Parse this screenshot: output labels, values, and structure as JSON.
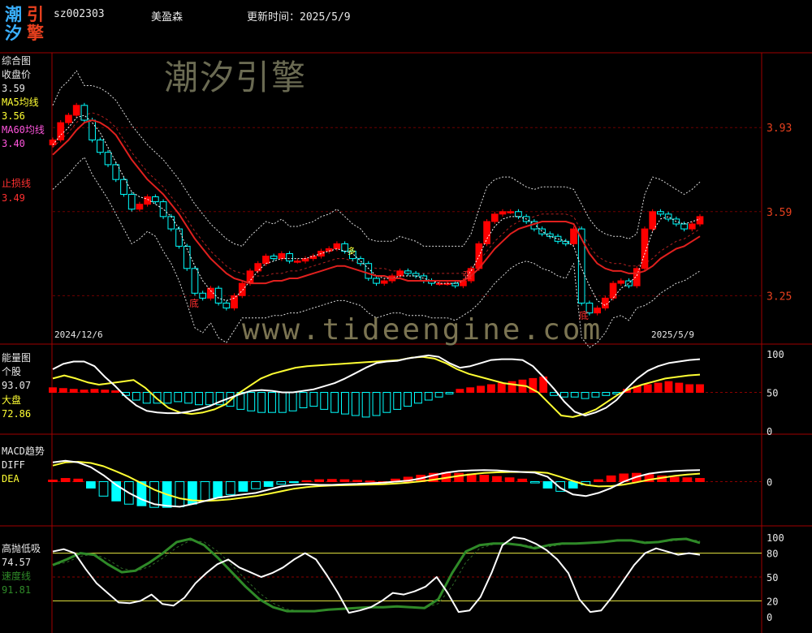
{
  "header": {
    "logo_chars": [
      "潮",
      "引",
      "汐",
      "擎"
    ],
    "code": "sz002303",
    "name": "美盈森",
    "update_label": "更新时间：2025/5/9"
  },
  "watermark": {
    "cn": "潮汐引擎",
    "url": "www.tideengine.com"
  },
  "colors": {
    "up": "#ff0000",
    "down": "#00ffff",
    "ma60": "#e0201e",
    "yellow": "#ffff33",
    "green": "#2f8a28",
    "grid": "#a00000"
  },
  "main_panel": {
    "labels": {
      "title": "综合图",
      "close_label": "收盘价",
      "close_value": "3.59",
      "ma5_label": "MA5均线",
      "ma5_value": "3.56",
      "ma60_label": "MA60均线",
      "ma60_value": "3.40",
      "stop_label": "止损线",
      "stop_value": "3.49"
    },
    "axis_ticks": [
      "3.93",
      "3.59",
      "3.25"
    ],
    "date_start": "2024/12/6",
    "date_end": "2025/5/9",
    "marks": {
      "bottom1": "底",
      "bottom2": "底",
      "strong": "强",
      "dup": "多"
    }
  },
  "energy_panel": {
    "labels": {
      "title": "能量图",
      "stock_label": "个股",
      "stock_value": "93.07",
      "market_label": "大盘",
      "market_value": "72.86"
    },
    "axis_ticks": [
      "100",
      "50",
      "0"
    ]
  },
  "macd_panel": {
    "labels": {
      "title": "MACD趋势",
      "diff_label": "DIFF",
      "dea_label": "DEA"
    },
    "axis_ticks": [
      "0"
    ]
  },
  "absorb_panel": {
    "labels": {
      "title": "高抛低吸",
      "value1": "74.57",
      "speed_label": "速度线",
      "speed_value": "91.81"
    },
    "axis_ticks": [
      "100",
      "80",
      "50",
      "20",
      "0"
    ]
  },
  "chart_data": [
    {
      "type": "candlestick",
      "panel": "综合图",
      "x_start": "2024/12/6",
      "x_end": "2025/5/9",
      "ylim": [
        3.1,
        4.2
      ],
      "close": [
        3.88,
        3.95,
        3.98,
        4.02,
        3.96,
        3.88,
        3.83,
        3.78,
        3.72,
        3.66,
        3.6,
        3.62,
        3.65,
        3.63,
        3.57,
        3.52,
        3.45,
        3.36,
        3.26,
        3.24,
        3.28,
        3.22,
        3.2,
        3.25,
        3.3,
        3.35,
        3.38,
        3.41,
        3.4,
        3.42,
        3.39,
        3.39,
        3.4,
        3.41,
        3.43,
        3.44,
        3.46,
        3.43,
        3.4,
        3.38,
        3.32,
        3.3,
        3.31,
        3.33,
        3.35,
        3.34,
        3.33,
        3.31,
        3.3,
        3.3,
        3.3,
        3.29,
        3.31,
        3.36,
        3.46,
        3.55,
        3.58,
        3.59,
        3.59,
        3.57,
        3.55,
        3.52,
        3.5,
        3.49,
        3.47,
        3.46,
        3.52,
        3.22,
        3.18,
        3.2,
        3.24,
        3.3,
        3.31,
        3.29,
        3.36,
        3.52,
        3.59,
        3.58,
        3.56,
        3.54,
        3.52,
        3.54,
        3.57
      ],
      "ma5": [
        3.86,
        3.9,
        3.93,
        3.97,
        3.98,
        3.95,
        3.91,
        3.85,
        3.79,
        3.73,
        3.67,
        3.65,
        3.64,
        3.62,
        3.6,
        3.57,
        3.52,
        3.44,
        3.37,
        3.31,
        3.27,
        3.24,
        3.23,
        3.24,
        3.27,
        3.31,
        3.35,
        3.38,
        3.39,
        3.4,
        3.4,
        3.4,
        3.4,
        3.41,
        3.42,
        3.43,
        3.44,
        3.43,
        3.42,
        3.39,
        3.36,
        3.33,
        3.32,
        3.32,
        3.33,
        3.33,
        3.33,
        3.32,
        3.31,
        3.3,
        3.3,
        3.3,
        3.31,
        3.35,
        3.41,
        3.48,
        3.53,
        3.56,
        3.57,
        3.57,
        3.56,
        3.54,
        3.51,
        3.49,
        3.48,
        3.47,
        3.45,
        3.36,
        3.29,
        3.23,
        3.21,
        3.24,
        3.28,
        3.3,
        3.33,
        3.42,
        3.51,
        3.56,
        3.57,
        3.55,
        3.54,
        3.55,
        3.56
      ],
      "ma60": [
        3.82,
        3.85,
        3.88,
        3.92,
        3.95,
        3.96,
        3.95,
        3.93,
        3.9,
        3.85,
        3.8,
        3.76,
        3.72,
        3.69,
        3.66,
        3.62,
        3.58,
        3.53,
        3.48,
        3.44,
        3.4,
        3.37,
        3.34,
        3.32,
        3.31,
        3.3,
        3.3,
        3.3,
        3.31,
        3.31,
        3.32,
        3.32,
        3.33,
        3.34,
        3.35,
        3.36,
        3.37,
        3.37,
        3.36,
        3.35,
        3.34,
        3.33,
        3.33,
        3.32,
        3.32,
        3.31,
        3.31,
        3.31,
        3.31,
        3.31,
        3.31,
        3.31,
        3.31,
        3.33,
        3.36,
        3.4,
        3.44,
        3.47,
        3.5,
        3.52,
        3.53,
        3.54,
        3.55,
        3.55,
        3.55,
        3.55,
        3.54,
        3.48,
        3.42,
        3.38,
        3.36,
        3.35,
        3.35,
        3.34,
        3.34,
        3.35,
        3.37,
        3.4,
        3.42,
        3.44,
        3.45,
        3.47,
        3.49
      ]
    },
    {
      "type": "line+bar",
      "panel": "能量图",
      "ylim": [
        0,
        100
      ],
      "stock": [
        80,
        87,
        90,
        90,
        84,
        70,
        58,
        44,
        33,
        26,
        24,
        23,
        23,
        25,
        28,
        32,
        38,
        43,
        48,
        52,
        53,
        52,
        50,
        50,
        52,
        54,
        58,
        62,
        68,
        75,
        82,
        88,
        90,
        91,
        94,
        96,
        98,
        96,
        88,
        82,
        84,
        88,
        92,
        93,
        93,
        92,
        84,
        70,
        55,
        38,
        25,
        20,
        24,
        30,
        40,
        55,
        68,
        78,
        84,
        88,
        90,
        92,
        93
      ],
      "market": [
        68,
        72,
        68,
        63,
        60,
        62,
        64,
        66,
        56,
        42,
        30,
        24,
        22,
        24,
        28,
        35,
        48,
        58,
        68,
        74,
        78,
        82,
        84,
        85,
        86,
        87,
        88,
        89,
        90,
        91,
        92,
        95,
        96,
        94,
        88,
        80,
        74,
        70,
        66,
        62,
        60,
        58,
        50,
        35,
        20,
        18,
        22,
        28,
        38,
        48,
        55,
        60,
        64,
        68,
        70,
        72,
        73
      ],
      "histogram": [
        6,
        5,
        4,
        3,
        4,
        3,
        2,
        -4,
        -10,
        -14,
        -14,
        -14,
        -12,
        -14,
        -16,
        -16,
        -16,
        -18,
        -22,
        -24,
        -26,
        -26,
        -26,
        -24,
        -20,
        -18,
        -22,
        -26,
        -28,
        -30,
        -32,
        -30,
        -26,
        -22,
        -18,
        -14,
        -10,
        -6,
        -2,
        4,
        6,
        8,
        10,
        12,
        14,
        16,
        18,
        20,
        -4,
        -6,
        -6,
        -8,
        -6,
        -4,
        -2,
        4,
        8,
        10,
        12,
        14,
        12,
        10,
        10
      ]
    },
    {
      "type": "line+bar",
      "panel": "MACD趋势",
      "ylim": [
        -0.12,
        0.12
      ],
      "diff": [
        0.06,
        0.065,
        0.06,
        0.045,
        0.02,
        -0.01,
        -0.035,
        -0.055,
        -0.07,
        -0.075,
        -0.078,
        -0.07,
        -0.06,
        -0.05,
        -0.045,
        -0.04,
        -0.035,
        -0.025,
        -0.015,
        -0.01,
        -0.008,
        -0.01,
        -0.01,
        -0.008,
        -0.007,
        -0.005,
        -0.003,
        0.0,
        0.003,
        0.01,
        0.02,
        0.028,
        0.033,
        0.035,
        0.036,
        0.035,
        0.032,
        0.03,
        0.028,
        0.015,
        -0.02,
        -0.04,
        -0.045,
        -0.035,
        -0.02,
        0.0,
        0.015,
        0.025,
        0.03,
        0.033,
        0.035,
        0.036
      ],
      "dea": [
        0.05,
        0.06,
        0.062,
        0.058,
        0.048,
        0.032,
        0.015,
        -0.005,
        -0.025,
        -0.04,
        -0.052,
        -0.058,
        -0.06,
        -0.058,
        -0.055,
        -0.05,
        -0.045,
        -0.038,
        -0.03,
        -0.022,
        -0.017,
        -0.014,
        -0.012,
        -0.011,
        -0.01,
        -0.009,
        -0.008,
        -0.006,
        -0.003,
        0.001,
        0.006,
        0.012,
        0.018,
        0.023,
        0.027,
        0.029,
        0.03,
        0.03,
        0.03,
        0.027,
        0.015,
        0.002,
        -0.01,
        -0.015,
        -0.014,
        -0.009,
        -0.002,
        0.006,
        0.012,
        0.018,
        0.022,
        0.025
      ],
      "histogram": [
        0.005,
        0.01,
        0.008,
        -0.02,
        -0.045,
        -0.06,
        -0.07,
        -0.075,
        -0.08,
        -0.08,
        -0.078,
        -0.07,
        -0.06,
        -0.05,
        -0.04,
        -0.03,
        -0.022,
        -0.015,
        -0.008,
        -0.003,
        0.003,
        0.006,
        0.007,
        0.006,
        0.004,
        0.002,
        0.0,
        0.008,
        0.014,
        0.02,
        0.026,
        0.028,
        0.026,
        0.024,
        0.02,
        0.016,
        0.012,
        0.008,
        -0.004,
        -0.02,
        -0.03,
        -0.02,
        -0.01,
        0.006,
        0.018,
        0.024,
        0.026,
        0.022,
        0.018,
        0.014,
        0.012,
        0.01
      ]
    },
    {
      "type": "line",
      "panel": "高抛低吸",
      "ylim": [
        0,
        100
      ],
      "value": [
        82,
        85,
        80,
        60,
        42,
        30,
        18,
        17,
        20,
        28,
        16,
        14,
        24,
        42,
        55,
        66,
        72,
        62,
        56,
        50,
        55,
        62,
        72,
        80,
        72,
        52,
        30,
        5,
        8,
        12,
        20,
        30,
        28,
        32,
        38,
        50,
        30,
        6,
        8,
        25,
        55,
        90,
        100,
        98,
        92,
        84,
        72,
        55,
        22,
        6,
        8,
        25,
        45,
        65,
        80,
        86,
        82,
        78,
        80,
        78
      ],
      "speed": [
        65,
        72,
        80,
        78,
        66,
        56,
        58,
        68,
        80,
        94,
        98,
        90,
        74,
        56,
        38,
        22,
        12,
        7,
        7,
        7,
        9,
        10,
        11,
        12,
        12,
        13,
        12,
        11,
        22,
        55,
        82,
        90,
        92,
        92,
        90,
        86,
        90,
        92,
        92,
        93,
        94,
        96,
        96,
        93,
        94,
        97,
        98,
        93
      ]
    }
  ]
}
